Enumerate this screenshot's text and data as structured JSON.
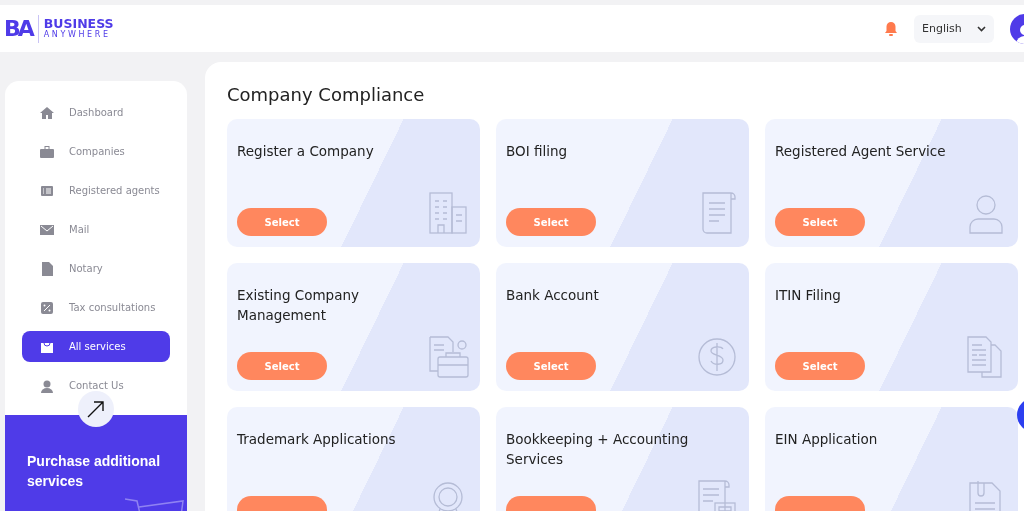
{
  "header": {
    "logo": {
      "mark": "BA",
      "line1": "BUSINESS",
      "line2": "ANYWHERE"
    },
    "language": "English"
  },
  "sidebar": {
    "items": [
      {
        "label": "Dashboard",
        "selected": false
      },
      {
        "label": "Companies",
        "selected": false
      },
      {
        "label": "Registered agents",
        "selected": false
      },
      {
        "label": "Mail",
        "selected": false
      },
      {
        "label": "Notary",
        "selected": false
      },
      {
        "label": "Tax consultations",
        "selected": false
      },
      {
        "label": "All services",
        "selected": true
      },
      {
        "label": "Contact Us",
        "selected": false
      }
    ],
    "promo": {
      "title": "Purchase additional services"
    }
  },
  "main": {
    "title": "Company Compliance",
    "cards": [
      {
        "title": "Register a Company",
        "button": "Select"
      },
      {
        "title": "BOI filing",
        "button": "Select"
      },
      {
        "title": "Registered Agent Service",
        "button": "Select"
      },
      {
        "title": "Existing Company Management",
        "button": "Select"
      },
      {
        "title": "Bank Account",
        "button": "Select"
      },
      {
        "title": "ITIN Filing",
        "button": "Select"
      },
      {
        "title": "Trademark Applications"
      },
      {
        "title": "Bookkeeping + Accounting Services"
      },
      {
        "title": "EIN Application"
      }
    ]
  }
}
